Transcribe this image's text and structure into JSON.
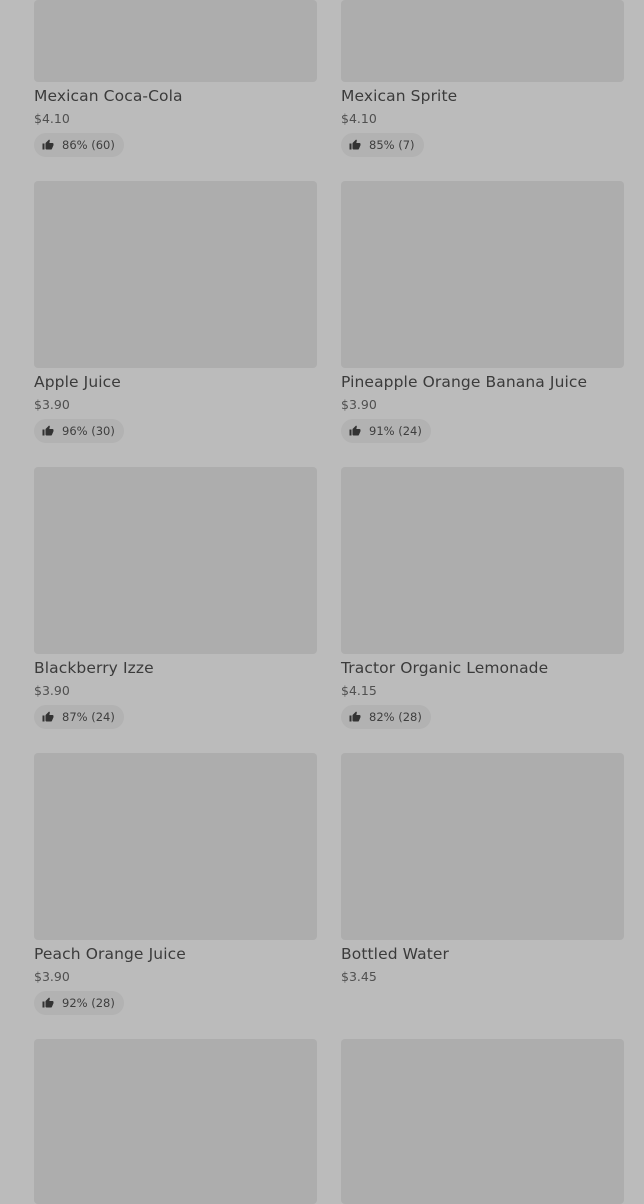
{
  "items": [
    {
      "name": "Mexican Coca-Cola",
      "price": "$4.10",
      "rating": "86% (60)"
    },
    {
      "name": "Mexican Sprite",
      "price": "$4.10",
      "rating": "85% (7)"
    },
    {
      "name": "Apple Juice",
      "price": "$3.90",
      "rating": "96% (30)"
    },
    {
      "name": "Pineapple Orange Banana Juice",
      "price": "$3.90",
      "rating": "91% (24)"
    },
    {
      "name": "Blackberry Izze",
      "price": "$3.90",
      "rating": "87% (24)"
    },
    {
      "name": "Tractor Organic Lemonade",
      "price": "$4.15",
      "rating": "82% (28)"
    },
    {
      "name": "Peach Orange Juice",
      "price": "$3.90",
      "rating": "92% (28)"
    },
    {
      "name": "Bottled Water",
      "price": "$3.45",
      "rating": null
    }
  ],
  "icons": {
    "rating": "thumbs-up-icon"
  }
}
